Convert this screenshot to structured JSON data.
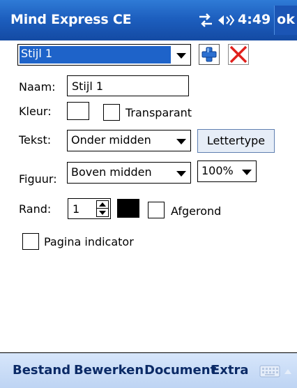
{
  "titlebar": {
    "title": "Mind Express CE",
    "time": "4:49",
    "ok_label": "ok",
    "icons": [
      "connectivity-icon",
      "volume-icon"
    ]
  },
  "style_select": {
    "value": "Stijl 1"
  },
  "toolbar": {
    "add_icon": "plus-icon",
    "delete_icon": "red-x-icon"
  },
  "form": {
    "naam_label": "Naam:",
    "naam_value": "Stijl 1",
    "kleur_label": "Kleur:",
    "transparant_label": "Transparant",
    "tekst_label": "Tekst:",
    "tekst_value": "Onder midden",
    "lettertype_label": "Lettertype",
    "figuur_label": "Figuur:",
    "figuur_value": "Boven midden",
    "zoom_value": "100%",
    "rand_label": "Rand:",
    "rand_value": "1",
    "border_color": "#000000",
    "afgerond_label": "Afgerond",
    "pagina_label": "Pagina indicator"
  },
  "menubar": {
    "items": [
      "Bestand",
      "Bewerken",
      "Document",
      "Extra"
    ],
    "keyboard_icon": "keyboard-icon"
  },
  "colors": {
    "titlebar": "#1d5fbf",
    "selection": "#1e63c9",
    "menubar": "#c8dbf6",
    "menu_text": "#0b2a66",
    "delete_red": "#e0201c",
    "add_blue": "#2b6fd0"
  }
}
